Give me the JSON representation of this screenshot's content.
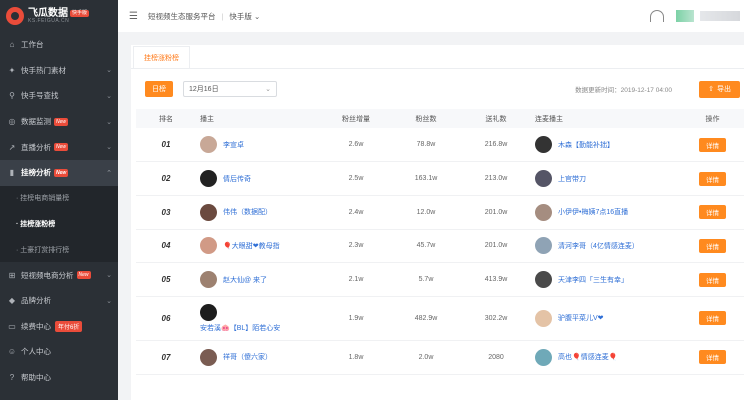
{
  "brand": {
    "name": "飞瓜数据",
    "sub": "KS.FEIGUA.CN",
    "badge": "快手版"
  },
  "sidebar": {
    "items": [
      {
        "label": "工作台",
        "icon": "home-icon",
        "chev": false
      },
      {
        "label": "快手热门素材",
        "icon": "fire-icon",
        "chev": true
      },
      {
        "label": "快手号查找",
        "icon": "search-icon",
        "chev": true
      },
      {
        "label": "数据监测",
        "icon": "monitor-icon",
        "chev": true,
        "tag": "New"
      },
      {
        "label": "直播分析",
        "icon": "trend-icon",
        "chev": true,
        "tag": "New"
      },
      {
        "label": "挂榜分析",
        "icon": "bar-chart-icon",
        "chev": true,
        "tag": "New",
        "active": true
      },
      {
        "label": "短视频电商分析",
        "icon": "cart-icon",
        "chev": true,
        "tag": "New"
      },
      {
        "label": "品牌分析",
        "icon": "diamond-icon",
        "chev": true
      },
      {
        "label": "续费中心",
        "icon": "card-icon",
        "chev": false,
        "discount": "年付6折"
      },
      {
        "label": "个人中心",
        "icon": "user-icon",
        "chev": false
      },
      {
        "label": "帮助中心",
        "icon": "help-icon",
        "chev": false
      }
    ],
    "subitems": [
      "· 挂榜电商销量榜",
      "· 挂榜涨粉榜",
      "· 土豪打赏排行榜"
    ]
  },
  "topbar": {
    "platform": "短视频生态服务平台",
    "version": "快手版"
  },
  "tab": "挂榜涨粉榜",
  "filter": {
    "period": "日榜",
    "date": "12月16日",
    "update": "数据更新时间：2019-12-17 04:00",
    "export": "导出"
  },
  "table": {
    "headers": [
      "排名",
      "播主",
      "粉丝增量",
      "粉丝数",
      "送礼数",
      "连麦播主",
      "操作"
    ],
    "detail": "详情",
    "rows": [
      {
        "rank": "01",
        "anchor": "李宣卓",
        "growth": "2.6w",
        "fans": "78.8w",
        "gifts": "216.8w",
        "partner": "木森【勤能补拙】",
        "ac": "#c8a897",
        "pc": "#333"
      },
      {
        "rank": "02",
        "anchor": "倩后传奇",
        "growth": "2.5w",
        "fans": "163.1w",
        "gifts": "213.0w",
        "partner": "上官带刀",
        "ac": "#222",
        "pc": "#556"
      },
      {
        "rank": "03",
        "anchor": "伟伟（数据配）",
        "growth": "2.4w",
        "fans": "12.0w",
        "gifts": "201.0w",
        "partner": "小伊伊•梅姨7点16直播",
        "ac": "#6b4a3f",
        "pc": "#a58d80"
      },
      {
        "rank": "04",
        "anchor": "🎈大眼甜❤教母指",
        "growth": "2.3w",
        "fans": "45.7w",
        "gifts": "201.0w",
        "partner": "清河李哥（4亿情感连麦）",
        "ac": "#d19a86",
        "pc": "#8fa3b5"
      },
      {
        "rank": "05",
        "anchor": "赵大仙@ 来了",
        "growth": "2.1w",
        "fans": "5.7w",
        "gifts": "413.9w",
        "partner": "天津李四「三生有幸」",
        "ac": "#9d8170",
        "pc": "#4a4a4a"
      },
      {
        "rank": "06",
        "anchor": "安若溪🐽【BL】陌若心安",
        "growth": "1.9w",
        "fans": "482.9w",
        "gifts": "302.2w",
        "partner": "驴腹平菜儿V❤",
        "ac": "#1d1d1d",
        "pc": "#e4c3a6",
        "tall": true
      },
      {
        "rank": "07",
        "anchor": "祥哥（傻六家）",
        "growth": "1.8w",
        "fans": "2.0w",
        "gifts": "2080",
        "partner": "高也🎈情感连麦🎈",
        "ac": "#7a5c52",
        "pc": "#6fa9b8"
      }
    ]
  }
}
